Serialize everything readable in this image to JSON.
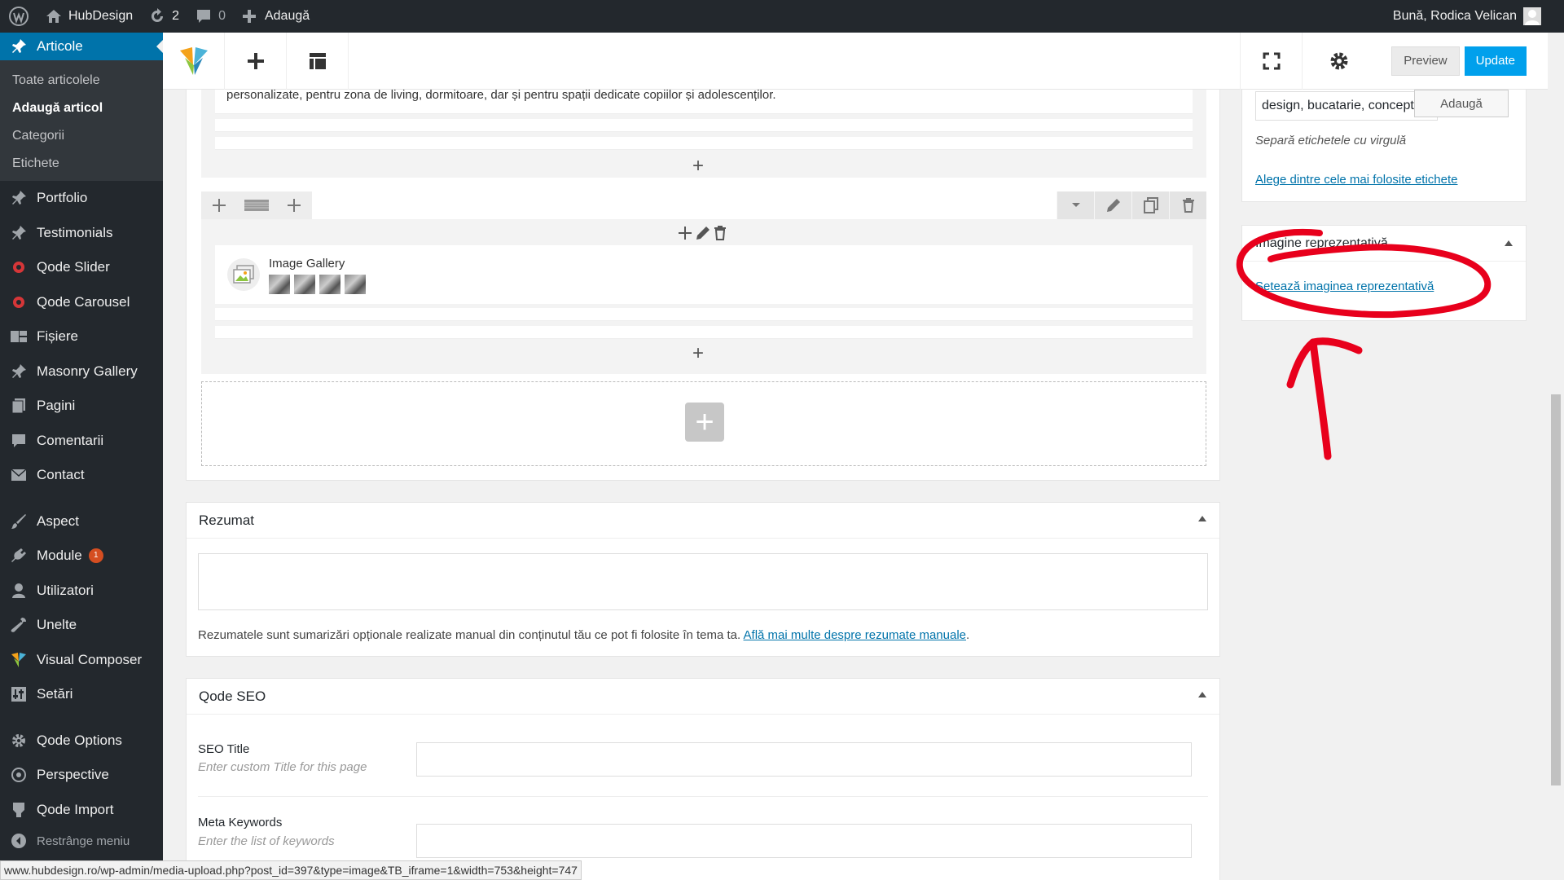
{
  "adminbar": {
    "site_name": "HubDesign",
    "updates_count": "2",
    "comments_count": "0",
    "new_label": "Adaugă",
    "greeting": "Bună, Rodica Velican"
  },
  "sidebar": {
    "current": "Articole",
    "submenu": [
      "Toate articolele",
      "Adaugă articol",
      "Categorii",
      "Etichete"
    ],
    "items": {
      "portfolio": "Portfolio",
      "testimonials": "Testimonials",
      "qode_slider": "Qode Slider",
      "qode_carousel": "Qode Carousel",
      "fisiere": "Fișiere",
      "masonry_gallery": "Masonry Gallery",
      "pagini": "Pagini",
      "comentarii": "Comentarii",
      "contact": "Contact",
      "aspect": "Aspect",
      "module": "Module",
      "module_badge": "1",
      "utilizatori": "Utilizatori",
      "unelte": "Unelte",
      "visual_composer": "Visual Composer",
      "setari": "Setări",
      "qode_options": "Qode Options",
      "perspective": "Perspective",
      "qode_import": "Qode Import",
      "collapse": "Restrânge meniu"
    }
  },
  "toolbar": {
    "preview_label": "Preview",
    "update_label": "Update"
  },
  "editor": {
    "text_snippet": "personalizate, pentru zona de living, dormitoare, dar și pentru spații dedicate copiilor și adolescenților.",
    "gallery_title": "Image Gallery"
  },
  "excerpt": {
    "title": "Rezumat",
    "description": "Rezumatele sunt sumarizări opționale realizate manual din conținutul tău ce pot fi folosite în tema ta. ",
    "link": "Află mai multe despre rezumate manuale",
    "period": "."
  },
  "seo": {
    "title": "Qode SEO",
    "seo_title_label": "SEO Title",
    "seo_title_hint": "Enter custom Title for this page",
    "meta_keywords_label": "Meta Keywords",
    "meta_keywords_hint": "Enter the list of keywords"
  },
  "tags": {
    "input_value": "design, bucatarie, concept",
    "add_button": "Adaugă",
    "hint": "Separă etichetele cu virgulă",
    "choose_link": "Alege dintre cele mai folosite etichete"
  },
  "featured_image": {
    "title": "Imagine reprezentativă",
    "set_link": "Setează imaginea reprezentativă"
  },
  "statusbar": {
    "url": "www.hubdesign.ro/wp-admin/media-upload.php?post_id=397&type=image&TB_iframe=1&width=753&height=747"
  },
  "colors": {
    "admin_dark": "#23282d",
    "accent_blue": "#0073aa",
    "update_blue": "#00a0ec",
    "annotation_red": "#e8001c"
  }
}
